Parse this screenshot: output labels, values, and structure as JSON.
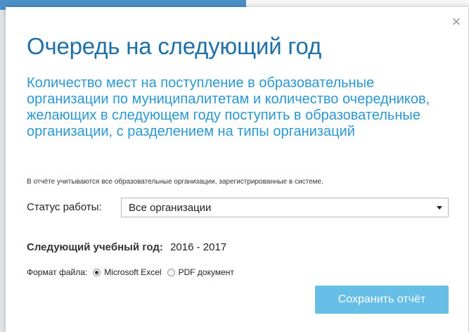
{
  "dialog": {
    "title": "Очередь на следующий год",
    "subtitle": "Количество мест на поступление в образовательные организации по муниципалитетам и количество очередников, желающих в следующем году поступить в образовательные организации, с разделением на типы организаций",
    "note": "В отчёте учитываются все образовательные организации, зарегистрированные в системе.",
    "close_symbol": "×",
    "close_icon": "close-icon"
  },
  "status": {
    "label": "Статус работы:",
    "selected": "Все организации"
  },
  "year": {
    "label": "Следующий учебный год:",
    "value": "2016 - 2017"
  },
  "format": {
    "label": "Формат файла:",
    "options": [
      {
        "label": "Microsoft Excel",
        "checked": true
      },
      {
        "label": "PDF документ",
        "checked": false
      }
    ]
  },
  "actions": {
    "save_label": "Сохранить отчёт"
  },
  "colors": {
    "title": "#1f6fa8",
    "subtitle": "#2b97d3",
    "button": "#67bfe7"
  }
}
